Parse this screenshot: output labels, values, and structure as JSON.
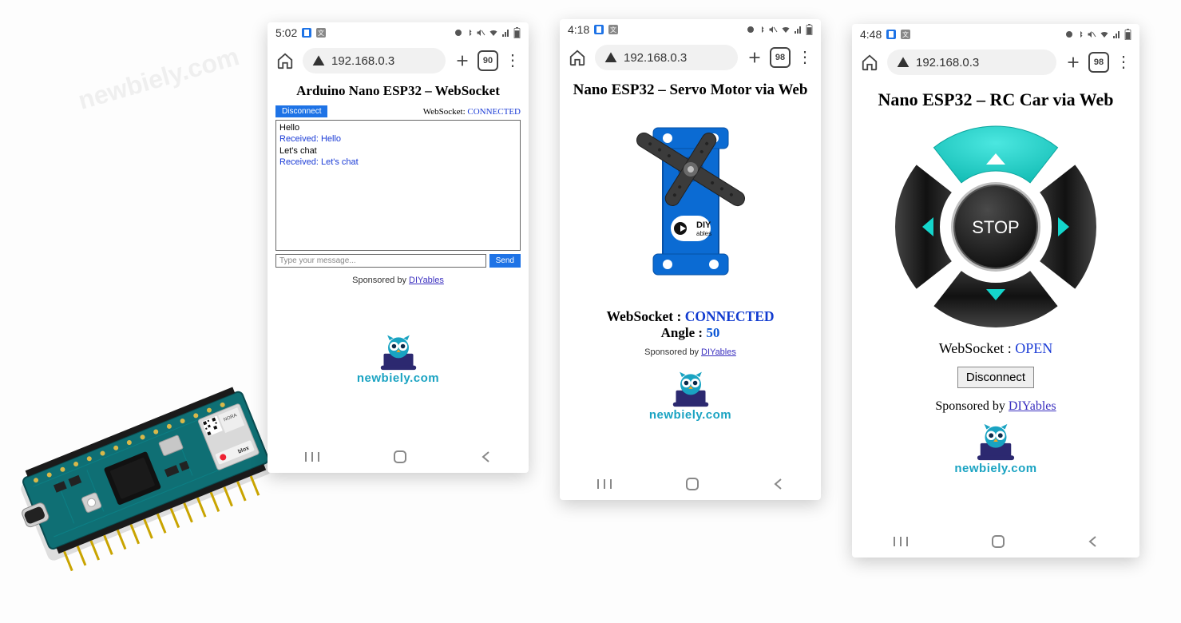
{
  "watermark": "newbiely.com",
  "logo_text": "newbiely.com",
  "phone1": {
    "time": "5:02",
    "url": "192.168.0.3",
    "tabcount": "90",
    "title": "Arduino Nano ESP32 – WebSocket",
    "disconnect_label": "Disconnect",
    "ws_label": "WebSocket:",
    "ws_status": "CONNECTED",
    "log": {
      "l1": "Hello",
      "l2": "Received: Hello",
      "l3": "Let's chat",
      "l4": "Received: Let's chat"
    },
    "input_placeholder": "Type your message...",
    "send_label": "Send",
    "sponsor_prefix": "Sponsored by ",
    "sponsor_link": "DIYables"
  },
  "phone2": {
    "time": "4:18",
    "url": "192.168.0.3",
    "tabcount": "98",
    "title": "Nano ESP32 – Servo Motor via Web",
    "ws_label": "WebSocket : ",
    "ws_status": "CONNECTED",
    "angle_label": "Angle : ",
    "angle_value": "50",
    "sponsor_prefix": "Sponsored by ",
    "sponsor_link": "DIYables",
    "servo_logo_text": "DIY",
    "servo_logo_sub": "ables"
  },
  "phone3": {
    "time": "4:48",
    "url": "192.168.0.3",
    "tabcount": "98",
    "title": "Nano ESP32 – RC Car via Web",
    "stop_label": "STOP",
    "ws_label": "WebSocket : ",
    "ws_status": "OPEN",
    "disconnect_label": "Disconnect",
    "sponsor_prefix": "Sponsored by ",
    "sponsor_link": "DIYables"
  }
}
